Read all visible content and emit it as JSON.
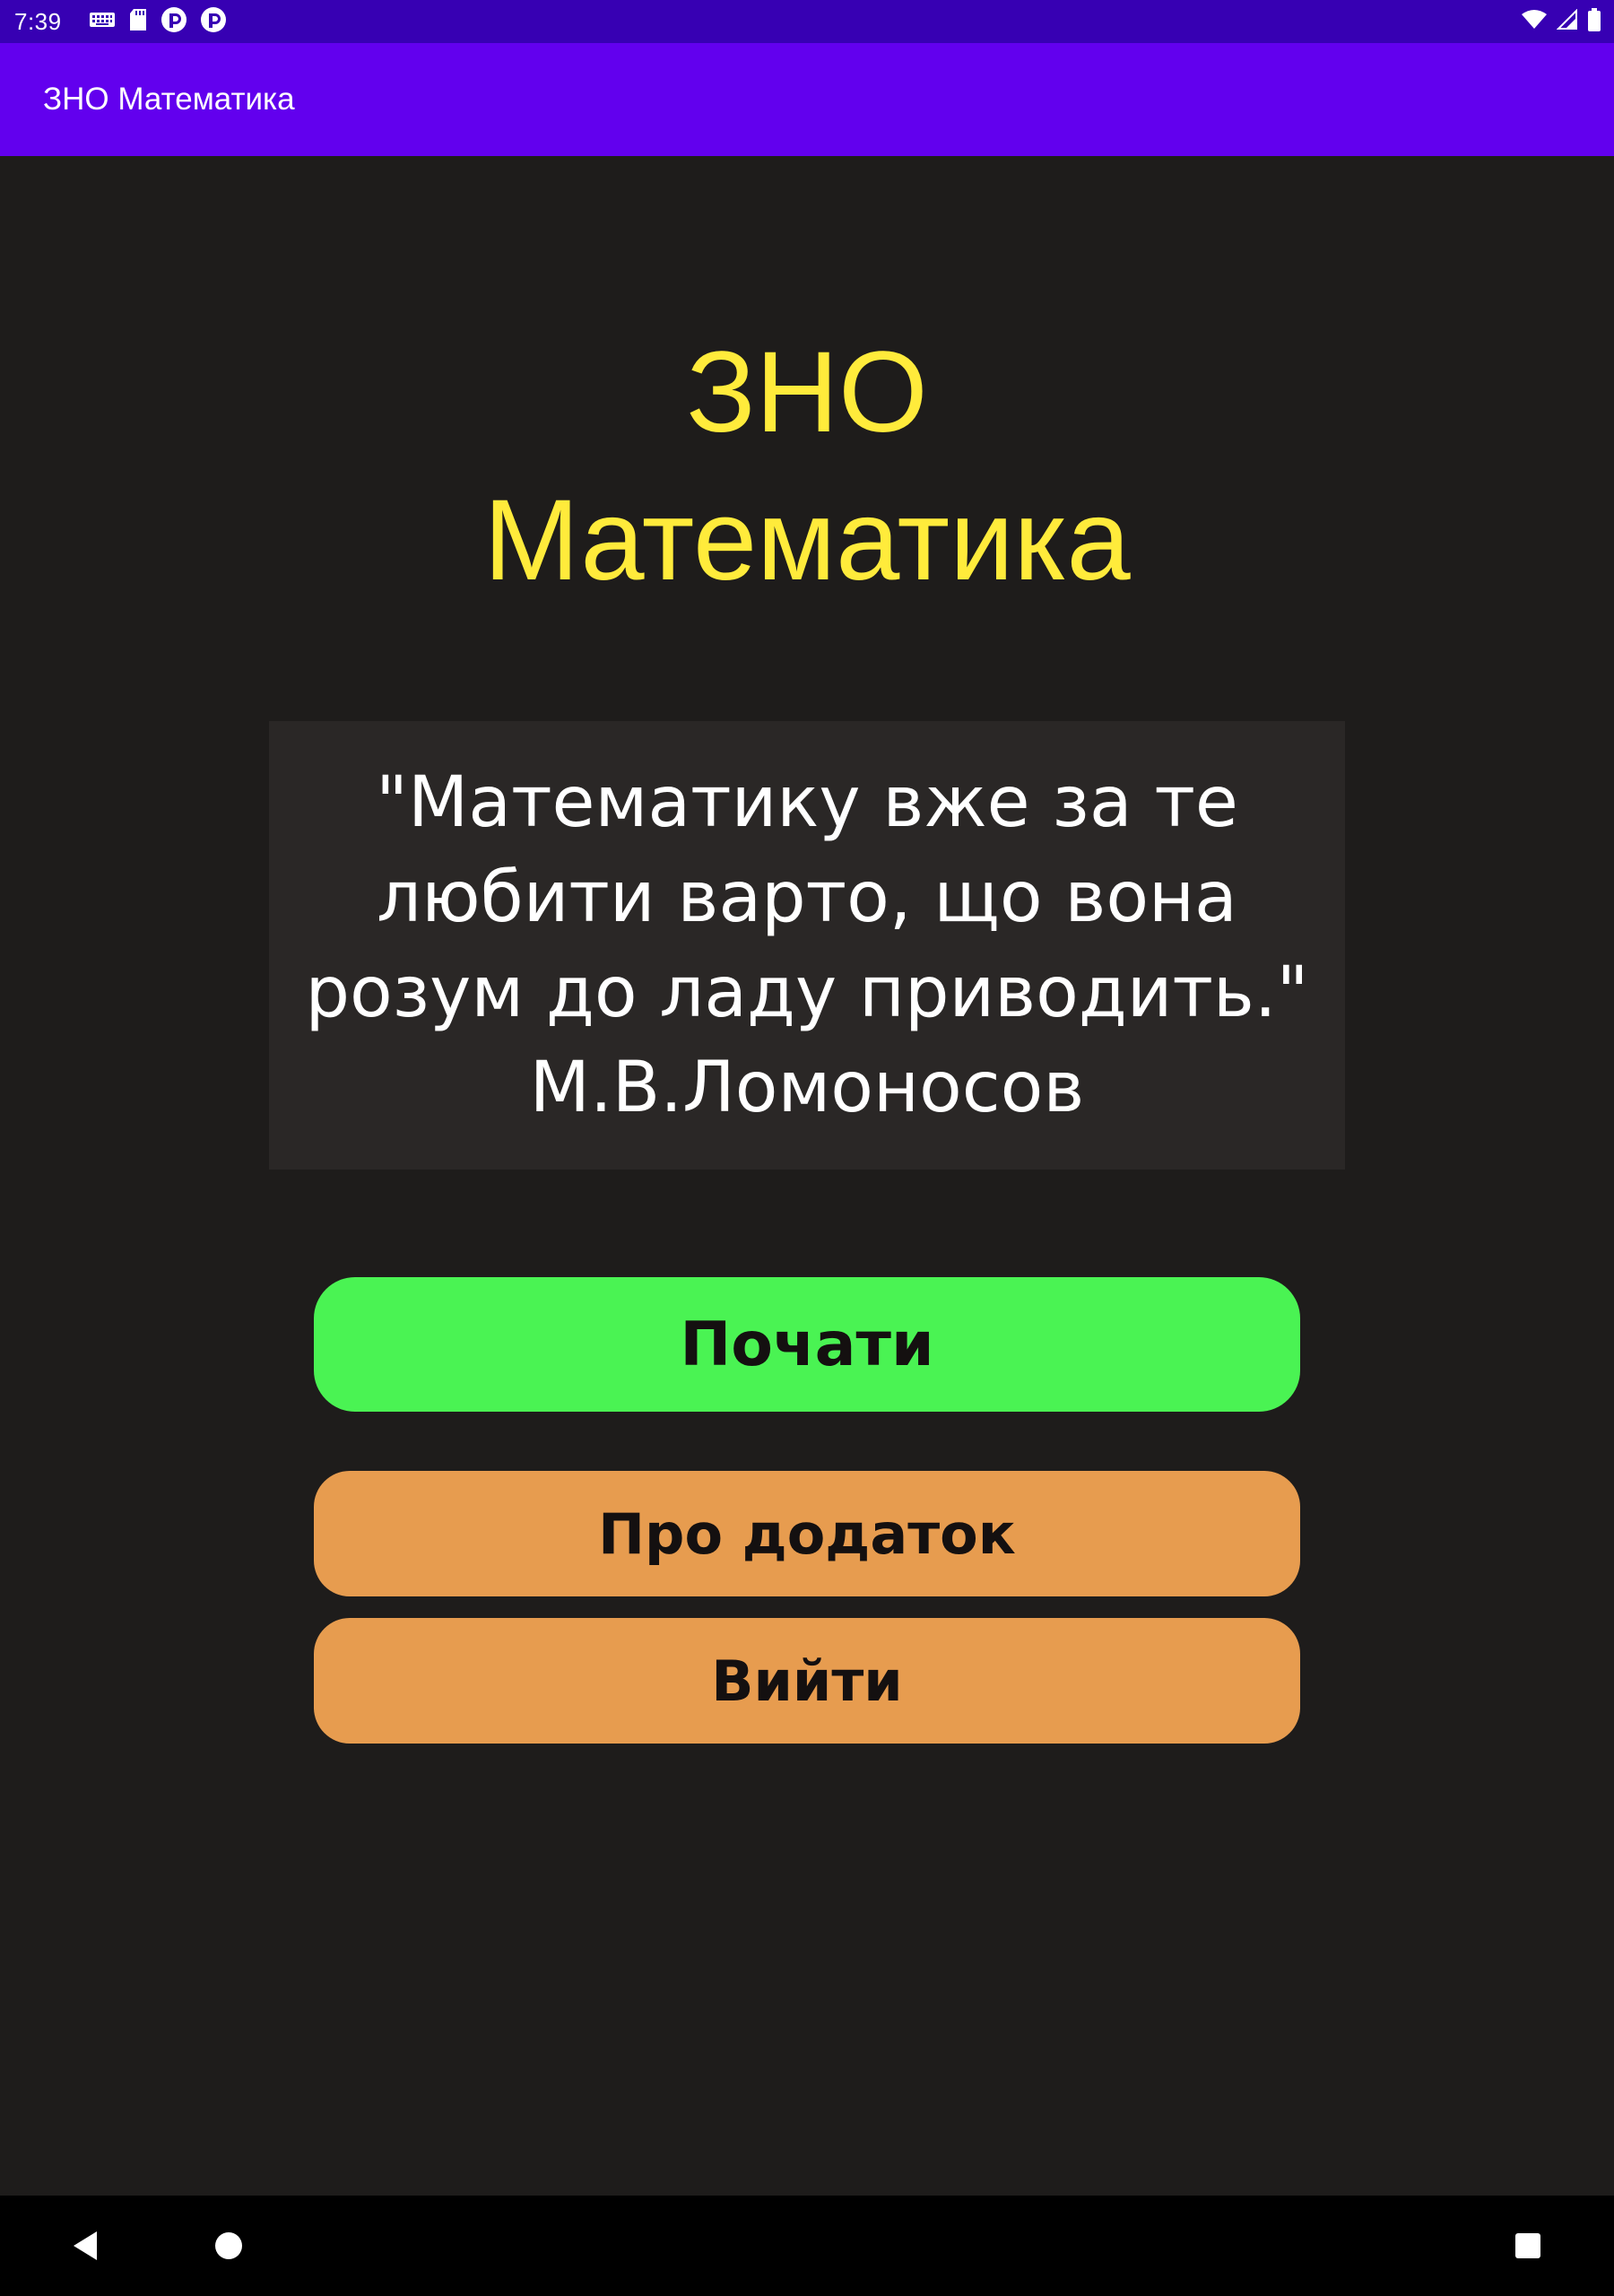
{
  "status_bar": {
    "time": "7:39",
    "left_icons": [
      "keyboard-icon",
      "sd-card-icon",
      "app-notification-icon",
      "app-notification-icon"
    ],
    "right_icons": [
      "wifi-icon",
      "cellular-signal-icon",
      "battery-icon"
    ]
  },
  "app_bar": {
    "title": "ЗНО Математика",
    "color": "#6200ee"
  },
  "main": {
    "headline_line1": "ЗНО",
    "headline_line2": "Математика",
    "headline_color": "#ffeb3b",
    "quote_lines": [
      "\"Математику вже за те",
      "любити варто, що вона",
      "розум до ладу приводить.\"",
      "М.В.Ломоносов"
    ]
  },
  "buttons": {
    "start_label": "Почати",
    "start_color": "#4af353",
    "about_label": "Про додаток",
    "exit_label": "Вийти",
    "secondary_color": "#e79c4f"
  },
  "nav_bar": {
    "icons": [
      "back-icon",
      "home-icon",
      "recents-icon"
    ]
  }
}
